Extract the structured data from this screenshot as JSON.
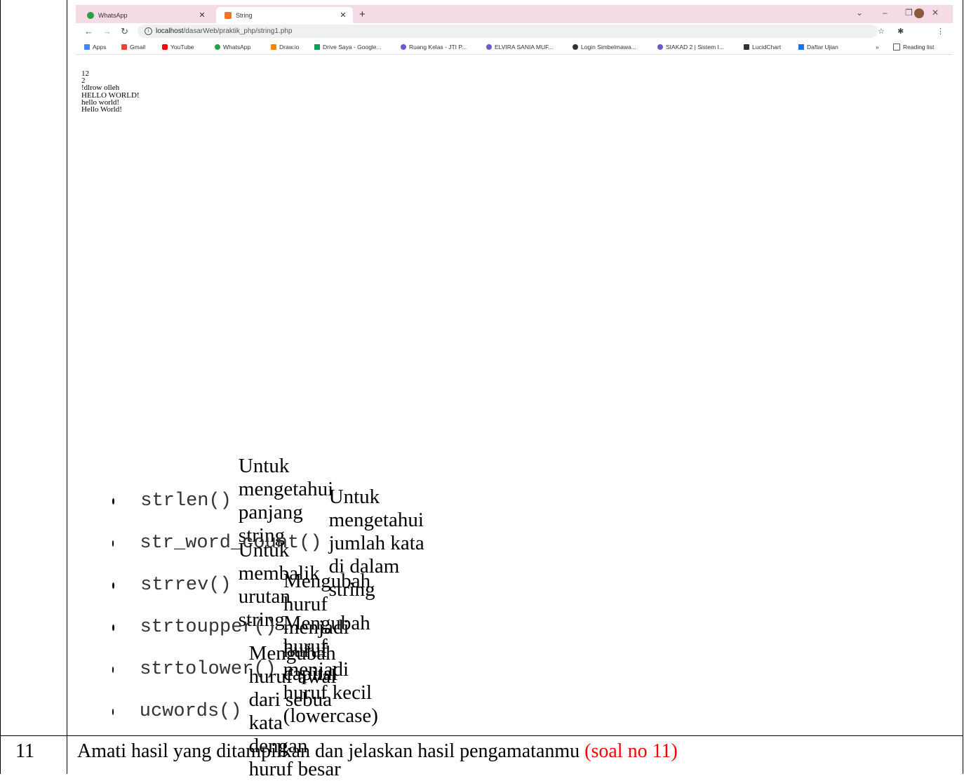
{
  "browser": {
    "tabs": [
      {
        "title": "WhatsApp",
        "icon": "whatsapp-icon"
      },
      {
        "title": "String",
        "icon": "xampp-icon"
      }
    ],
    "url_host": "localhost",
    "url_path": "/dasarWeb/praktik_php/string1.php",
    "bookmarks": [
      "Apps",
      "Gmail",
      "YouTube",
      "WhatsApp",
      "Draw.io",
      "Drive Saya - Google...",
      "Ruang Kelas - JTI P...",
      "ELVIRA SANIA MUF...",
      "Login Simbelmawa...",
      "SIAKAD 2 | Sistem I...",
      "LucidChart",
      "Daftar Ujian"
    ],
    "reading_list": "Reading list",
    "output_lines": [
      "12",
      "2",
      "!dlrow olleh",
      "HELLO WORLD!",
      "hello world!",
      "Hello World!"
    ]
  },
  "functions": [
    {
      "code": "strlen()",
      "desc": "Untuk mengetahui panjang string"
    },
    {
      "code": "str_word_count()",
      "desc": "Untuk mengetahui jumlah kata di dalam string"
    },
    {
      "code": "strrev()",
      "desc": "Untuk membalik urutan string"
    },
    {
      "code": "strtoupper()",
      "desc": "Mengubah huruf menjadi huruf capital"
    },
    {
      "code": "strtolower()",
      "desc": "Mengubah huruf menjadi huruf kecil (lowercase)"
    },
    {
      "code": "ucwords()",
      "desc": "Mengubah huruf awal dari sebua kata dengan huruf besar"
    }
  ],
  "row": {
    "number": "11",
    "text": "Amati hasil yang ditampilkan dan jelaskan hasil pengamatanmu ",
    "note": "(soal no 11)",
    "note_color": "#ff0000"
  }
}
